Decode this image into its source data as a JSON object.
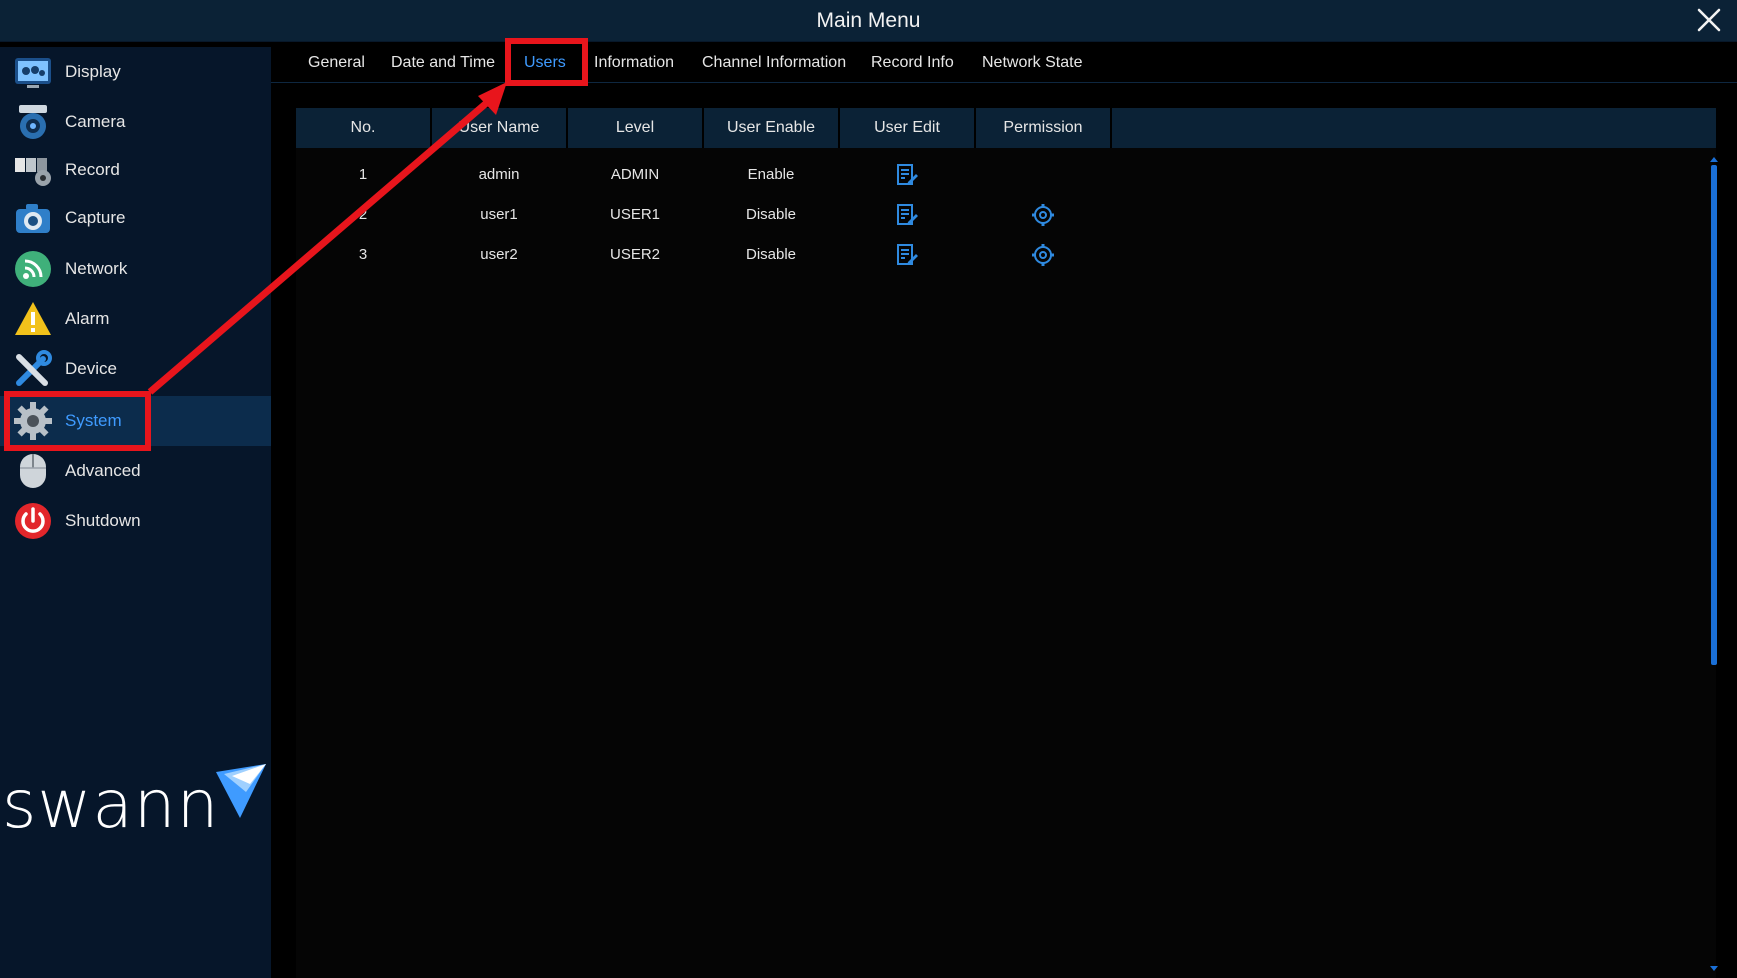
{
  "window": {
    "title": "Main Menu"
  },
  "sidebar": {
    "items": [
      {
        "label": "Display",
        "icon": "display-icon"
      },
      {
        "label": "Camera",
        "icon": "camera-icon"
      },
      {
        "label": "Record",
        "icon": "record-icon"
      },
      {
        "label": "Capture",
        "icon": "capture-icon"
      },
      {
        "label": "Network",
        "icon": "network-icon"
      },
      {
        "label": "Alarm",
        "icon": "alarm-icon"
      },
      {
        "label": "Device",
        "icon": "device-icon"
      },
      {
        "label": "System",
        "icon": "gear-icon",
        "active": true
      },
      {
        "label": "Advanced",
        "icon": "mouse-icon"
      },
      {
        "label": "Shutdown",
        "icon": "power-icon"
      }
    ],
    "logo_text": "swann"
  },
  "tabs": [
    {
      "label": "General"
    },
    {
      "label": "Date and Time"
    },
    {
      "label": "Users",
      "active": true
    },
    {
      "label": "Information"
    },
    {
      "label": "Channel Information"
    },
    {
      "label": "Record Info"
    },
    {
      "label": "Network State"
    }
  ],
  "users_table": {
    "columns": [
      "No.",
      "User Name",
      "Level",
      "User Enable",
      "User Edit",
      "Permission"
    ],
    "rows": [
      {
        "no": "1",
        "name": "admin",
        "level": "ADMIN",
        "enable": "Enable",
        "edit_icon": "edit-icon",
        "permission_icon": null
      },
      {
        "no": "2",
        "name": "user1",
        "level": "USER1",
        "enable": "Disable",
        "edit_icon": "edit-icon",
        "permission_icon": "gear-icon"
      },
      {
        "no": "3",
        "name": "user2",
        "level": "USER2",
        "enable": "Disable",
        "edit_icon": "edit-icon",
        "permission_icon": "gear-icon"
      }
    ]
  },
  "colors": {
    "accent": "#3f9bff",
    "titlebar": "#0b2236",
    "sidebar": "#06162a",
    "annotation": "#e8151c"
  }
}
